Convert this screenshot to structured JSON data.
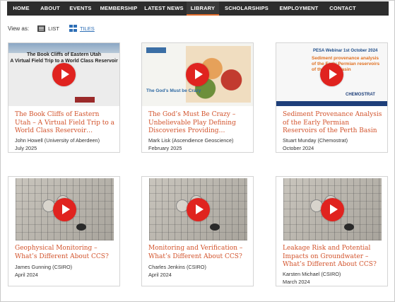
{
  "nav": {
    "items": [
      "HOME",
      "ABOUT",
      "EVENTS",
      "MEMBERSHIP",
      "LATEST NEWS",
      "LIBRARY",
      "SCHOLARSHIPS",
      "EMPLOYMENT",
      "CONTACT"
    ],
    "active": "LIBRARY"
  },
  "view": {
    "label": "View as:",
    "list": "LIST",
    "tiles": "TILES",
    "selected": "TILES"
  },
  "colors": {
    "title": "#d2532c",
    "nav_bg": "#2d2d2d",
    "play": "#e0231f",
    "link": "#2e6fb6"
  },
  "thumbs": {
    "t1": "The Book Cliffs of Eastern Utah\nA Virtual Field Trip to a World Class Reservoir",
    "t2": "The God's Must be Crazy",
    "t3_hdr": "PESA Webinar  1st October 2024",
    "t3_title": "Sediment provenance analysis of the Early Permian reservoirs of the Perth Basin",
    "t3_brand": "CHEMOSTRAT"
  },
  "cards": [
    {
      "title": "The Book Cliffs of Eastern Utah – A Virtual Field Trip to a World Class Reservoir…",
      "author": "John Howell (University of Aberdeen)",
      "date": "July 2025"
    },
    {
      "title": "The God’s Must Be Crazy – Unbelievable Play Defining Discoveries Providing…",
      "author": "Mark Lisk (Ascendience Geoscience)",
      "date": "February 2025"
    },
    {
      "title": "Sediment Provenance Analysis of the Early Permian Reservoirs of the Perth Basin",
      "author": "Stuart Munday (Chemostrat)",
      "date": "October 2024"
    },
    {
      "title": "Geophysical Monitoring – What’s Different About CCS?",
      "author": "James Gunning (CSIRO)",
      "date": "April 2024"
    },
    {
      "title": "Monitoring and Verification – What’s Different About CCS?",
      "author": "Charles Jenkins (CSIRO)",
      "date": "April 2024"
    },
    {
      "title": "Leakage Risk and Potential Impacts on Groundwater – What’s Different About CCS?",
      "author": "Karsten Michael (CSIRO)",
      "date": "March 2024"
    }
  ]
}
